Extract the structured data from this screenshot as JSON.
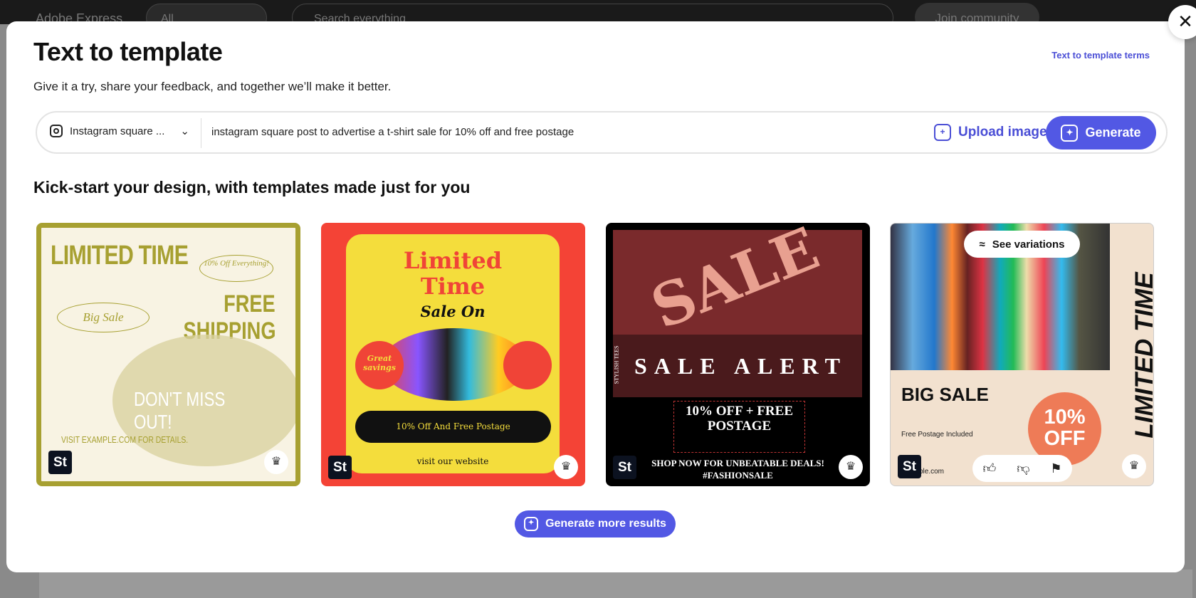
{
  "background": {
    "app_name": "Adobe Express",
    "filter": "All",
    "search_placeholder": "Search everything",
    "join": "Join community"
  },
  "modal": {
    "title": "Text to template",
    "subtitle": "Give it a try, share your feedback, and together we’ll make it better.",
    "terms_link": "Text to template terms",
    "format": "Instagram square ...",
    "prompt": "instagram square post to advertise a t-shirt sale for 10% off and free postage",
    "upload_label": "Upload image",
    "generate_label": "Generate",
    "section_title": "Kick-start your design, with templates made just for you",
    "more_label": "Generate more results",
    "close_icon": "close-icon",
    "accent": "#5258e4"
  },
  "cards": [
    {
      "line1": "LIMITED TIME",
      "tag": "10% Off Everything!",
      "line2": "FREE",
      "line3": "SHIPPING",
      "script": "Big Sale",
      "middle": "DON'T MISS OUT!",
      "footer": "VISIT EXAMPLE.COM FOR DETAILS.",
      "badge": "St"
    },
    {
      "line1": "Limited",
      "line2": "Time",
      "line3": "Sale On",
      "circle": "Great savings",
      "pill": "10% Off And Free Postage",
      "footer": "visit our website",
      "badge": "St"
    },
    {
      "big": "SALE",
      "side": "STYLISH TEES",
      "headline": "SALE ALERT",
      "offer": "10% OFF + FREE POSTAGE",
      "footer1": "SHOP NOW FOR UNBEATABLE DEALS!",
      "footer2": "#FASHIONSALE",
      "badge": "St"
    },
    {
      "variations": "See variations",
      "side": "LIMITED TIME",
      "headline": "BIG SALE",
      "sub": "Free Postage Included",
      "circle1": "10%",
      "circle2": "OFF",
      "url": "ple.com",
      "badge": "St"
    }
  ]
}
